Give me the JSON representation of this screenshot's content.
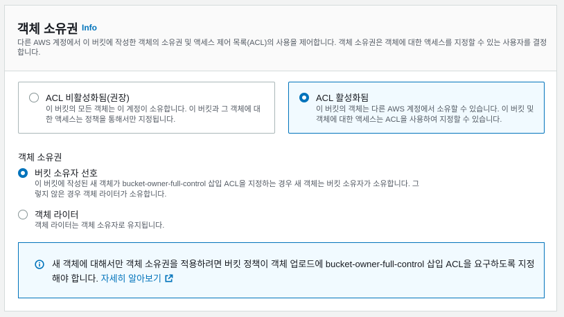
{
  "header": {
    "title": "객체 소유권",
    "info_link": "Info",
    "description": "다른 AWS 계정에서 이 버킷에 작성한 객체의 소유권 및 액세스 제어 목록(ACL)의 사용을 제어합니다. 객체 소유권은 객체에 대한 액세스를 지정할 수 있는 사용자를 결정합니다."
  },
  "acl_tiles": [
    {
      "label": "ACL 비활성화됨(권장)",
      "description": "이 버킷의 모든 객체는 이 계정이 소유합니다. 이 버킷과 그 객체에 대한 액세스는 정책을 통해서만 지정됩니다.",
      "selected": false
    },
    {
      "label": "ACL 활성화됨",
      "description": "이 버킷의 객체는 다른 AWS 계정에서 소유할 수 있습니다. 이 버킷 및 객체에 대한 액세스는 ACL을 사용하여 지정할 수 있습니다.",
      "selected": true
    }
  ],
  "ownership": {
    "label": "객체 소유권",
    "options": [
      {
        "label": "버킷 소유자 선호",
        "description": "이 버킷에 작성된 새 객체가 bucket-owner-full-control 삽입 ACL을 지정하는 경우 새 객체는 버킷 소유자가 소유합니다. 그렇지 않은 경우 객체 라이터가 소유합니다.",
        "selected": true
      },
      {
        "label": "객체 라이터",
        "description": "객체 라이터는 객체 소유자로 유지됩니다.",
        "selected": false
      }
    ]
  },
  "alert": {
    "text": "새 객체에 대해서만 객체 소유권을 적용하려면 버킷 정책이 객체 업로드에 bucket-owner-full-control 삽입 ACL을 요구하도록 지정해야 합니다. ",
    "link": "자세히 알아보기",
    "icon": "info-icon"
  },
  "colors": {
    "accent": "#0073bb",
    "selected_bg": "#f1faff",
    "text": "#16191f",
    "secondary_text": "#545b64"
  }
}
